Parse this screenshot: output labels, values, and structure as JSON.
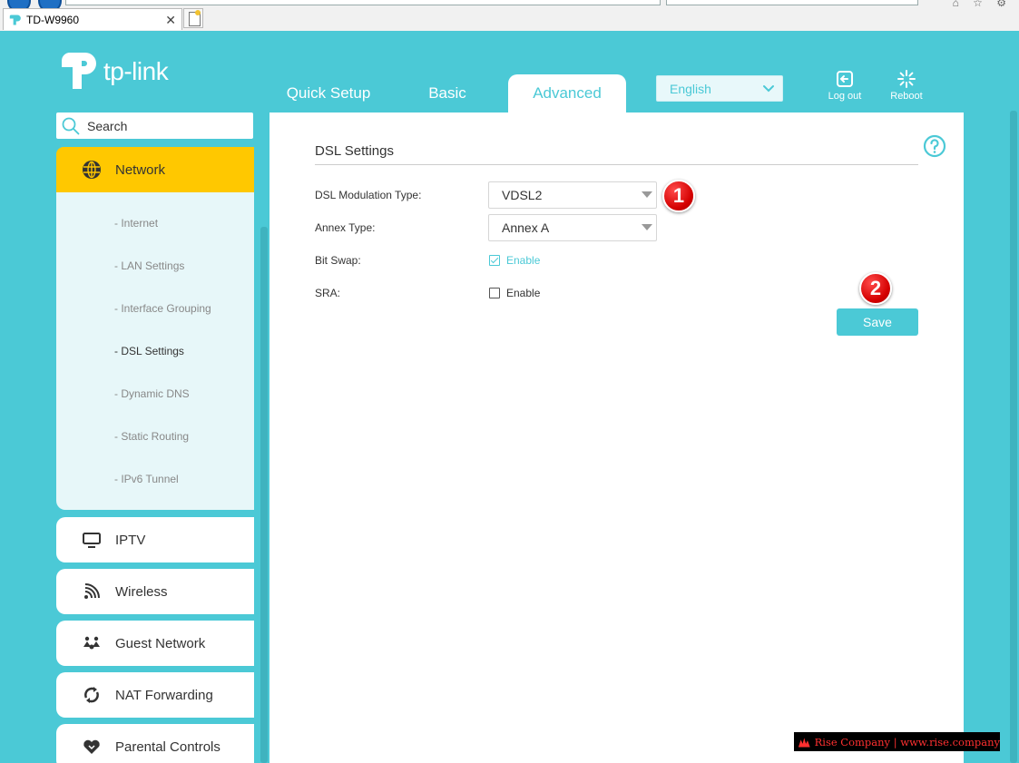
{
  "browser": {
    "tab_title": "TD-W9960",
    "close_glyph": "✕"
  },
  "header": {
    "brand": "tp-link",
    "tabs": [
      "Quick Setup",
      "Basic",
      "Advanced"
    ],
    "active_tab": "Advanced",
    "language": "English",
    "logout_label": "Log out",
    "reboot_label": "Reboot"
  },
  "sidebar": {
    "search_placeholder": "Search",
    "network": {
      "label": "Network",
      "icon": "globe-icon",
      "sub_items": [
        "- Internet",
        "- LAN Settings",
        "- Interface Grouping",
        "- DSL Settings",
        "- Dynamic DNS",
        "- Static Routing",
        "- IPv6 Tunnel"
      ],
      "active_sub_item": "- DSL Settings"
    },
    "items": [
      {
        "label": "IPTV",
        "icon": "monitor-icon"
      },
      {
        "label": "Wireless",
        "icon": "wifi-icon"
      },
      {
        "label": "Guest Network",
        "icon": "guest-network-icon"
      },
      {
        "label": "NAT Forwarding",
        "icon": "nat-forwarding-icon"
      },
      {
        "label": "Parental Controls",
        "icon": "heart-icon"
      }
    ]
  },
  "main": {
    "title": "DSL Settings",
    "fields": {
      "modulation": {
        "label": "DSL Modulation Type:",
        "value": "VDSL2"
      },
      "annex": {
        "label": "Annex Type:",
        "value": "Annex A"
      },
      "bitswap": {
        "label": "Bit Swap:",
        "option": "Enable",
        "checked": true
      },
      "sra": {
        "label": "SRA:",
        "option": "Enable",
        "checked": false
      }
    },
    "save_label": "Save",
    "markers": [
      "1",
      "2"
    ]
  },
  "watermark": "Rise Company | www.rise.company",
  "colors": {
    "accent": "#4bc9d6",
    "active_menu": "#ffc800",
    "submenu_bg": "#e7f7f9",
    "marker_red": "#d40000"
  }
}
